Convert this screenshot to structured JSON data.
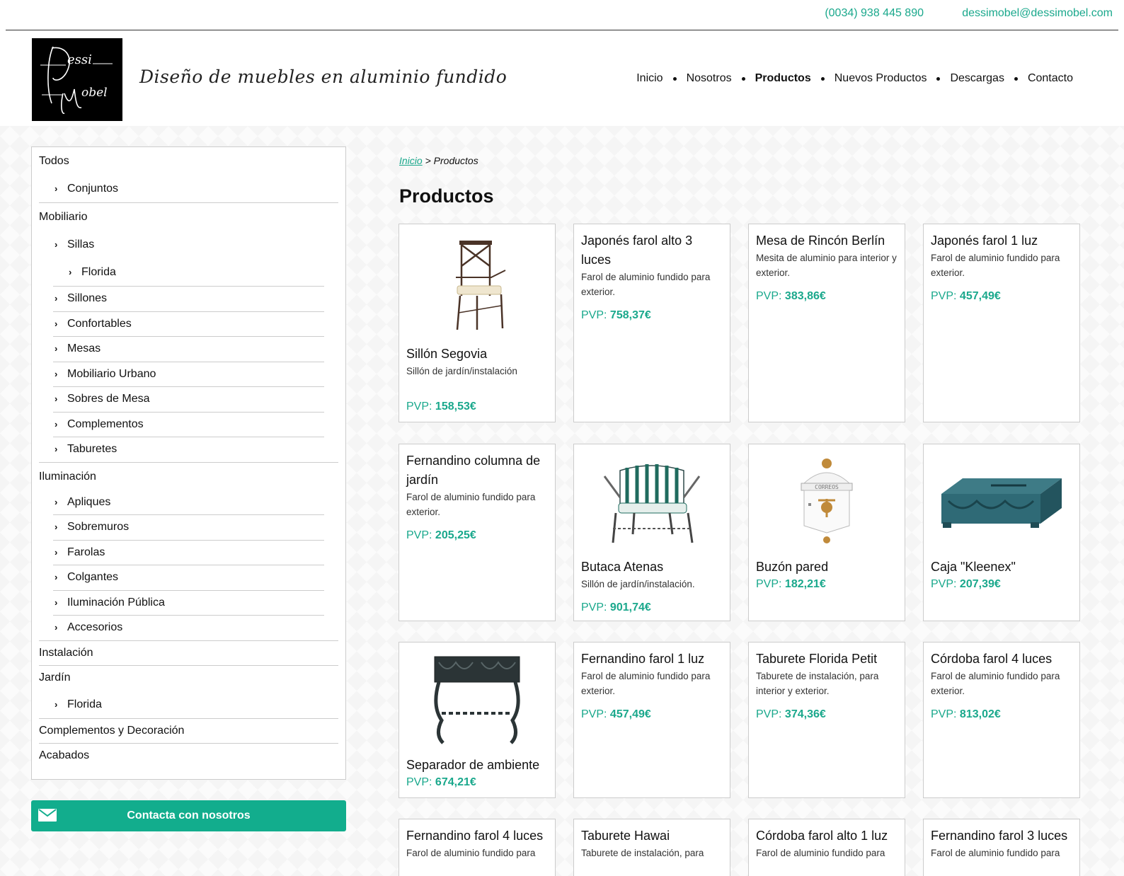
{
  "topbar": {
    "phone": "(0034) 938 445 890",
    "email": "dessimobel@dessimobel.com"
  },
  "header": {
    "logo_text": "Dessi Mobel",
    "tagline": "Diseño de muebles en aluminio fundido",
    "nav": [
      {
        "label": "Inicio",
        "active": false
      },
      {
        "label": "Nosotros",
        "active": false
      },
      {
        "label": "Productos",
        "active": true
      },
      {
        "label": "Nuevos Productos",
        "active": false
      },
      {
        "label": "Descargas",
        "active": false
      },
      {
        "label": "Contacto",
        "active": false
      }
    ]
  },
  "sidebar": {
    "todos": "Todos",
    "conjuntos": "Conjuntos",
    "mobiliario": "Mobiliario",
    "sillas": "Sillas",
    "florida": "Florida",
    "sillones": "Sillones",
    "confortables": "Confortables",
    "mesas": "Mesas",
    "mobiliario_urbano": "Mobiliario Urbano",
    "sobres_de_mesa": "Sobres de Mesa",
    "complementos": "Complementos",
    "taburetes": "Taburetes",
    "iluminacion": "Iluminación",
    "apliques": "Apliques",
    "sobremuros": "Sobremuros",
    "farolas": "Farolas",
    "colgantes": "Colgantes",
    "iluminacion_publica": "Iluminación Pública",
    "accesorios": "Accesorios",
    "instalacion": "Instalación",
    "jardin": "Jardín",
    "jardin_florida": "Florida",
    "complementos_decoracion": "Complementos y Decoración",
    "acabados": "Acabados"
  },
  "contact_button": {
    "label": "Contacta con nosotros",
    "icon": "mail-icon"
  },
  "breadcrumb": {
    "home": "Inicio",
    "separator": ">",
    "current": "Productos"
  },
  "page_title": "Productos",
  "price_prefix": "PVP:",
  "products": [
    {
      "name": "Sillón Segovia",
      "desc": "Sillón de jardín/instalación",
      "price": "158,53€",
      "image": "chair"
    },
    {
      "name": "Japonés farol alto 3 luces",
      "desc": "Farol de aluminio fundido para exterior.",
      "price": "758,37€"
    },
    {
      "name": "Mesa de Rincón Berlín",
      "desc": "Mesita de aluminio para interior y exterior.",
      "price": "383,86€"
    },
    {
      "name": "Japonés farol 1 luz",
      "desc": "Farol de aluminio fundido para exterior.",
      "price": "457,49€"
    },
    {
      "name": "Fernandino columna de jardín",
      "desc": "Farol de aluminio fundido para exterior.",
      "price": "205,25€"
    },
    {
      "name": "Butaca Atenas",
      "desc": "Sillón de jardín/instalación.",
      "price": "901,74€",
      "image": "armchair"
    },
    {
      "name": "Buzón pared",
      "desc": "",
      "price": "182,21€",
      "image": "mailbox",
      "image_text": "CORREOS"
    },
    {
      "name": "Caja \"Kleenex\"",
      "desc": "",
      "price": "207,39€",
      "image": "tissue-box"
    },
    {
      "name": "Separador de ambiente",
      "desc": "",
      "price": "674,21€",
      "image": "planter"
    },
    {
      "name": "Fernandino farol 1 luz",
      "desc": "Farol de aluminio fundido para exterior.",
      "price": "457,49€"
    },
    {
      "name": "Taburete Florida Petit",
      "desc": "Taburete de instalación, para interior y exterior.",
      "price": "374,36€"
    },
    {
      "name": "Córdoba farol 4 luces",
      "desc": "Farol de aluminio fundido para exterior.",
      "price": "813,02€"
    },
    {
      "name": "Fernandino farol 4 luces",
      "desc": "Farol de aluminio fundido para",
      "price": ""
    },
    {
      "name": "Taburete Hawai",
      "desc": "Taburete de instalación, para",
      "price": ""
    },
    {
      "name": "Córdoba farol alto 1 luz",
      "desc": "Farol de aluminio fundido para",
      "price": ""
    },
    {
      "name": "Fernandino farol 3 luces",
      "desc": "Farol de aluminio fundido para",
      "price": ""
    }
  ]
}
